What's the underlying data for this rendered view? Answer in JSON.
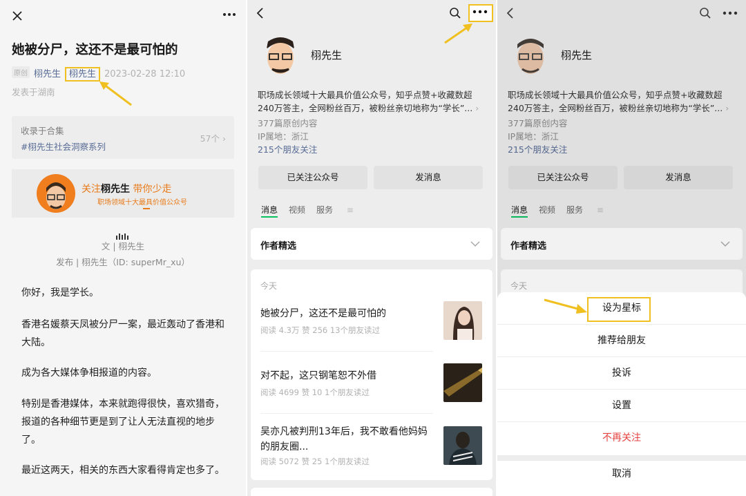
{
  "article": {
    "title": "她被分尸，这还不是最可怕的",
    "tag": "原创",
    "author": "栩先生",
    "author_boxed": "栩先生",
    "date": "2023-02-28 12:10",
    "location": "发表于湖南",
    "collection_label": "收录于合集",
    "collection_name": "#栩先生社会洞察系列",
    "collection_count": "57个",
    "banner_follow": "关注",
    "banner_name": "栩先生",
    "banner_slogan": "带你少走",
    "banner_sub": "职场领域十大最具价值公众号",
    "byline_author": "文 | 栩先生",
    "byline_publish": "发布 | 栩先生（ID: superMr_xu）",
    "paragraphs": [
      "你好，我是学长。",
      "香港名媛蔡天凤被分尸一案，最近轰动了香港和大陆。",
      "成为各大媒体争相报道的内容。",
      "特别是香港媒体，本来就跑得很快，喜欢猎奇，报道的各种细节更是到了让人无法直视的地步了。",
      "最近这两天，相关的东西大家看得肯定也多了。"
    ]
  },
  "account": {
    "name": "栩先生",
    "desc_line1": "职场成长领域十大最具价值公众号，知乎点赞+收藏数超",
    "desc_line2": "240万答主，全网粉丝百万，被粉丝亲切地称为“学长”...",
    "original_count": "377篇原创内容",
    "ip": "IP属地：浙江",
    "friends": "215个朋友关注",
    "followed_btn": "已关注公众号",
    "message_btn": "发消息",
    "tabs": [
      "消息",
      "视频",
      "服务"
    ],
    "featured": "作者精选",
    "today": "今天",
    "articles": [
      {
        "title": "她被分尸，这还不是最可怕的",
        "stats": "阅读 4.3万   赞 256   13个朋友读过"
      },
      {
        "title": "对不起，这只钢笔恕不外借",
        "stats": "阅读 4699   赞 10   1个朋友读过"
      },
      {
        "title": "吴亦凡被判刑13年后，我不敢看他妈妈的朋友圈...",
        "stats": "阅读 5072   赞 25   1个朋友读过"
      }
    ]
  },
  "sheet": {
    "star": "设为星标",
    "recommend": "推荐给朋友",
    "report": "投诉",
    "settings": "设置",
    "unfollow": "不再关注",
    "cancel": "取消"
  },
  "colors": {
    "highlight": "#f0c020",
    "link": "#576b95",
    "danger": "#e64340",
    "orange": "#e97a18"
  },
  "icons": [
    "close-icon",
    "more-icon",
    "back-icon",
    "search-icon",
    "chevron-right-icon",
    "chevron-down-icon",
    "menu-icon"
  ]
}
